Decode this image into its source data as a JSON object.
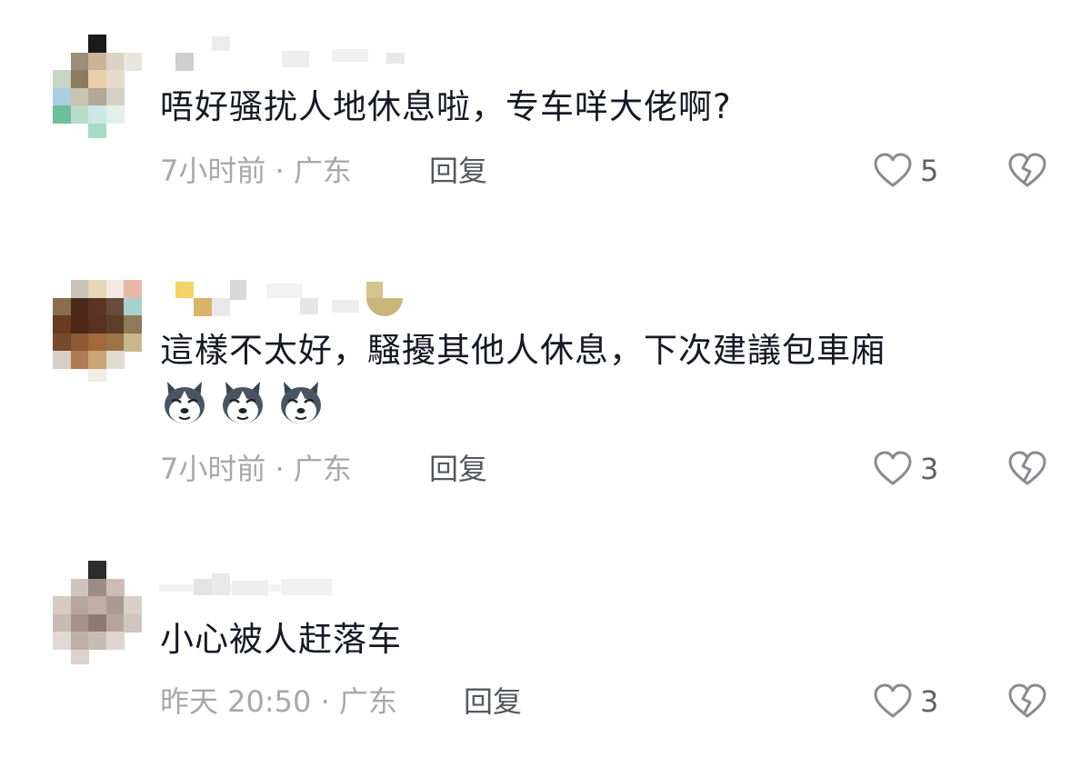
{
  "comments": [
    {
      "text": "唔好骚扰人地休息啦，专车咩大佬啊?",
      "meta": "7小时前 · 广东",
      "reply": "回复",
      "likes": "5",
      "emoji_count": 0
    },
    {
      "text": "這樣不太好，騷擾其他人休息，下次建議包車廂",
      "meta": "7小时前 · 广东",
      "reply": "回复",
      "likes": "3",
      "emoji_count": 3,
      "emoji_icon": "husky-dog-emoji"
    },
    {
      "text": "小心被人赶落车",
      "meta": "昨天 20:50 · 广东",
      "reply": "回复",
      "likes": "3",
      "emoji_count": 0
    }
  ],
  "icons": {
    "like": "heart-outline-icon",
    "dislike": "broken-heart-icon"
  },
  "colors": {
    "text": "#161823",
    "meta": "#a8a8ab",
    "reply": "#55575e",
    "icon": "#8a8b91"
  }
}
